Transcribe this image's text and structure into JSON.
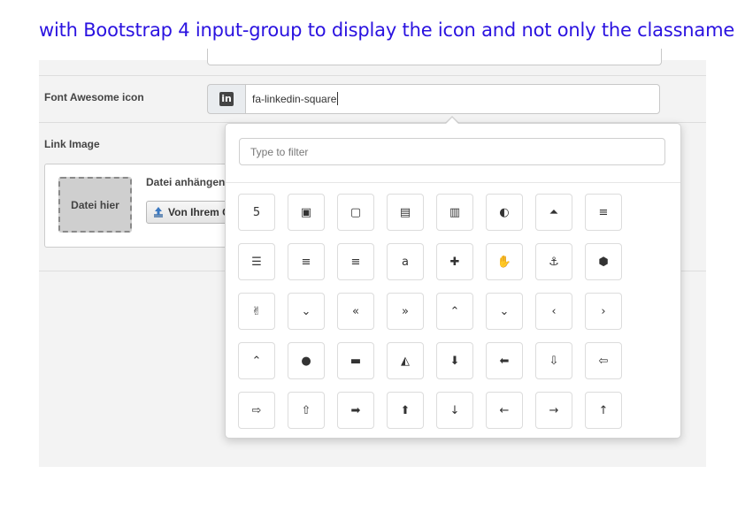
{
  "caption": "with Bootstrap 4 input-group to display the icon and not only the classname",
  "form": {
    "icon_field_label": "Font Awesome icon",
    "icon_field_value": "fa-linkedin-square",
    "icon_addon_glyph": "in",
    "link_image_label": "Link Image",
    "dropzone_text": "Datei hier",
    "attach_label": "Datei anhängen",
    "upload_button_label": "Von Ihrem C"
  },
  "picker": {
    "filter_placeholder": "Type to filter",
    "icons": [
      {
        "name": "500px-icon",
        "glyph": "5"
      },
      {
        "name": "address-book-icon",
        "glyph": "▣"
      },
      {
        "name": "address-book-o-icon",
        "glyph": "▢"
      },
      {
        "name": "address-card-icon",
        "glyph": "▤"
      },
      {
        "name": "address-card-o-icon",
        "glyph": "▥"
      },
      {
        "name": "adjust-icon",
        "glyph": "◐"
      },
      {
        "name": "adn-icon",
        "glyph": "⏶"
      },
      {
        "name": "align-center-icon",
        "glyph": "≡"
      },
      {
        "name": "align-justify-icon",
        "glyph": "☰"
      },
      {
        "name": "align-left-icon",
        "glyph": "≡"
      },
      {
        "name": "align-right-icon",
        "glyph": "≡"
      },
      {
        "name": "amazon-icon",
        "glyph": "a"
      },
      {
        "name": "ambulance-icon",
        "glyph": "✚"
      },
      {
        "name": "american-sign-language-icon",
        "glyph": "✋"
      },
      {
        "name": "anchor-icon",
        "glyph": "⚓"
      },
      {
        "name": "android-icon",
        "glyph": "⬢"
      },
      {
        "name": "angellist-icon",
        "glyph": "✌"
      },
      {
        "name": "angle-double-down-icon",
        "glyph": "⌄"
      },
      {
        "name": "angle-double-left-icon",
        "glyph": "«"
      },
      {
        "name": "angle-double-right-icon",
        "glyph": "»"
      },
      {
        "name": "angle-double-up-icon",
        "glyph": "⌃"
      },
      {
        "name": "angle-down-icon",
        "glyph": "⌄"
      },
      {
        "name": "angle-left-icon",
        "glyph": "‹"
      },
      {
        "name": "angle-right-icon",
        "glyph": "›"
      },
      {
        "name": "angle-up-icon",
        "glyph": "⌃"
      },
      {
        "name": "apple-icon",
        "glyph": "●"
      },
      {
        "name": "archive-icon",
        "glyph": "▬"
      },
      {
        "name": "area-chart-icon",
        "glyph": "◭"
      },
      {
        "name": "arrow-circle-down-icon",
        "glyph": "⬇"
      },
      {
        "name": "arrow-circle-left-icon",
        "glyph": "⬅"
      },
      {
        "name": "arrow-circle-o-down-icon",
        "glyph": "⇩"
      },
      {
        "name": "arrow-circle-o-left-icon",
        "glyph": "⇦"
      },
      {
        "name": "arrow-circle-o-right-icon",
        "glyph": "⇨"
      },
      {
        "name": "arrow-circle-o-up-icon",
        "glyph": "⇧"
      },
      {
        "name": "arrow-circle-right-icon",
        "glyph": "➡"
      },
      {
        "name": "arrow-circle-up-icon",
        "glyph": "⬆"
      },
      {
        "name": "arrow-down-icon",
        "glyph": "↓"
      },
      {
        "name": "arrow-left-icon",
        "glyph": "←"
      },
      {
        "name": "arrow-right-icon",
        "glyph": "→"
      },
      {
        "name": "arrow-up-icon",
        "glyph": "↑"
      }
    ]
  }
}
